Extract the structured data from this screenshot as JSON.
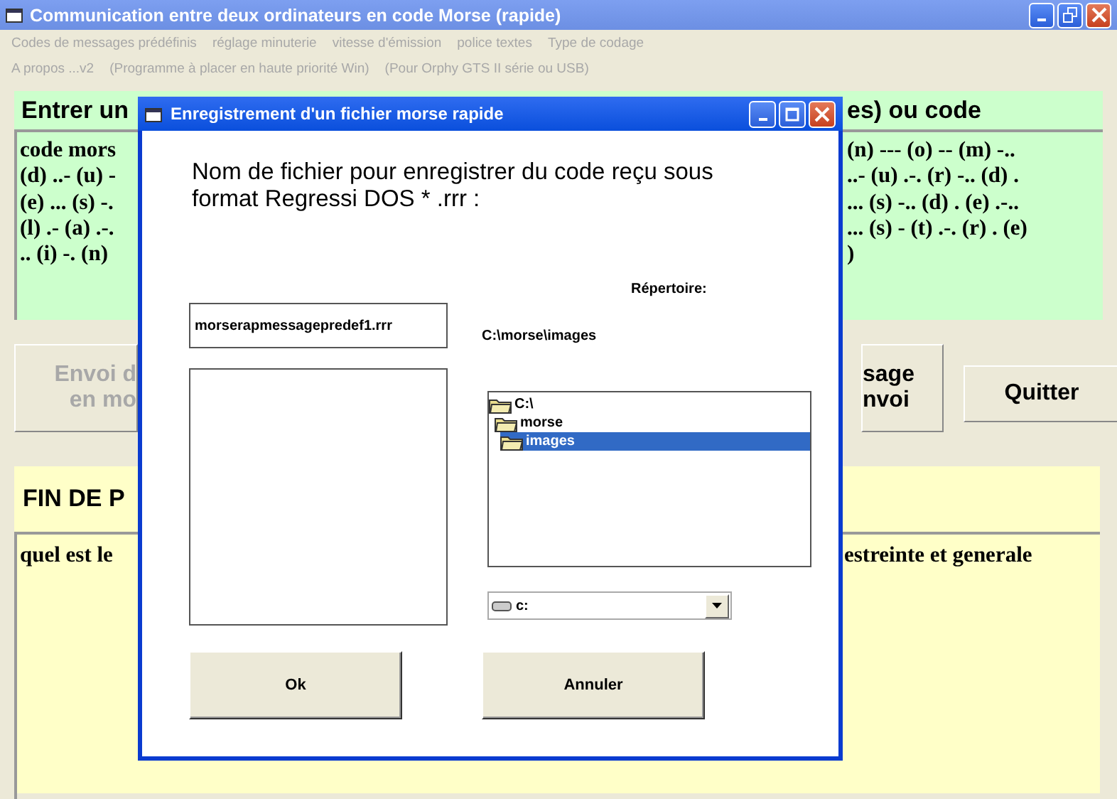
{
  "window": {
    "title": "Communication entre deux ordinateurs en code Morse (rapide)"
  },
  "menu_rows": [
    {
      "items": [
        "Codes de messages prédéfinis",
        "réglage minuterie",
        "vitesse d'émission",
        "police textes",
        "Type de codage"
      ]
    },
    {
      "items": [
        "A propos ...v2",
        "(Programme à placer en haute priorité Win)",
        "(Pour Orphy GTS II série ou USB)"
      ]
    }
  ],
  "input_panel": {
    "heading_left": "Entrer un",
    "heading_right": "es) ou code",
    "lines": [
      {
        "left": "code mors",
        "right": "(n) --- (o) -- (m) -.."
      },
      {
        "left": "(d) ..- (u) -",
        "right": "..- (u) .-. (r) -.. (d) ."
      },
      {
        "left": "(e) ... (s) -.",
        "right": "... (s) -.. (d) . (e) .-.."
      },
      {
        "left": "(l) .- (a) .-.",
        "right": "... (s) - (t) .-. (r) . (e)"
      },
      {
        "left": ".. (i) -. (n)",
        "right": ")"
      }
    ]
  },
  "send_button": {
    "lines": [
      "Envoi d",
      "en mo"
    ],
    "disabled": true
  },
  "message_button": {
    "lines": [
      "sage",
      "nvoi"
    ],
    "disabled": false
  },
  "quit_button": {
    "label": "Quitter",
    "disabled": false
  },
  "output_panel": {
    "heading": "FIN DE P",
    "text_left": "quel est le",
    "text_right": "estreinte et generale"
  },
  "dialog": {
    "title": "Enregistrement d'un fichier morse rapide",
    "prompt": "Nom de fichier pour enregistrer du code reçu sous format Regressi DOS * .rrr :",
    "filename": "morserapmessagepredef1.rrr",
    "directory_label": "Répertoire:",
    "directory_path": "C:\\morse\\images",
    "folders": [
      {
        "label": "C:\\",
        "selected": false,
        "children": [
          {
            "label": "morse",
            "selected": false,
            "children": [
              {
                "label": "images",
                "selected": true
              }
            ]
          }
        ]
      }
    ],
    "drive": "c:",
    "buttons": [
      {
        "label": "Ok"
      },
      {
        "label": "Annuler"
      }
    ]
  }
}
